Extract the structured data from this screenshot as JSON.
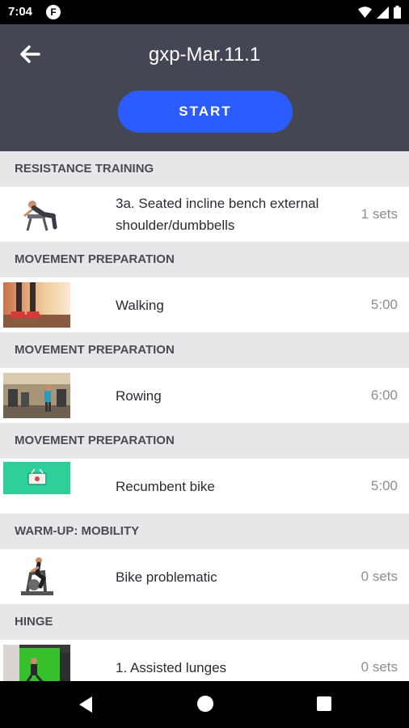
{
  "status_bar": {
    "time": "7:04",
    "badge": "F"
  },
  "header": {
    "title": "gxp-Mar.11.1",
    "start_label": "START"
  },
  "sections": [
    {
      "header": "RESISTANCE TRAINING",
      "item": {
        "title": "3a. Seated incline bench external shoulder/dumbbells",
        "value": "1 sets",
        "thumb": "seated-bench-exercise"
      }
    },
    {
      "header": "MOVEMENT PREPARATION",
      "item": {
        "title": "Walking",
        "value": "5:00",
        "thumb": "walking-feet"
      }
    },
    {
      "header": "MOVEMENT PREPARATION",
      "item": {
        "title": "Rowing",
        "value": "6:00",
        "thumb": "gym-rowing"
      }
    },
    {
      "header": "MOVEMENT PREPARATION",
      "item": {
        "title": "Recumbent bike",
        "value": "5:00",
        "thumb": "video-placeholder"
      }
    },
    {
      "header": "WARM-UP: MOBILITY",
      "item": {
        "title": "Bike problematic",
        "value": "0 sets",
        "thumb": "exercise-bike"
      }
    },
    {
      "header": "HINGE",
      "item": {
        "title": "1. Assisted lunges",
        "value": "0 sets",
        "thumb": "green-screen-lunges"
      }
    }
  ],
  "colors": {
    "header_bg": "#454653",
    "accent": "#2b5cff",
    "section_bg": "#e7e7ea"
  }
}
